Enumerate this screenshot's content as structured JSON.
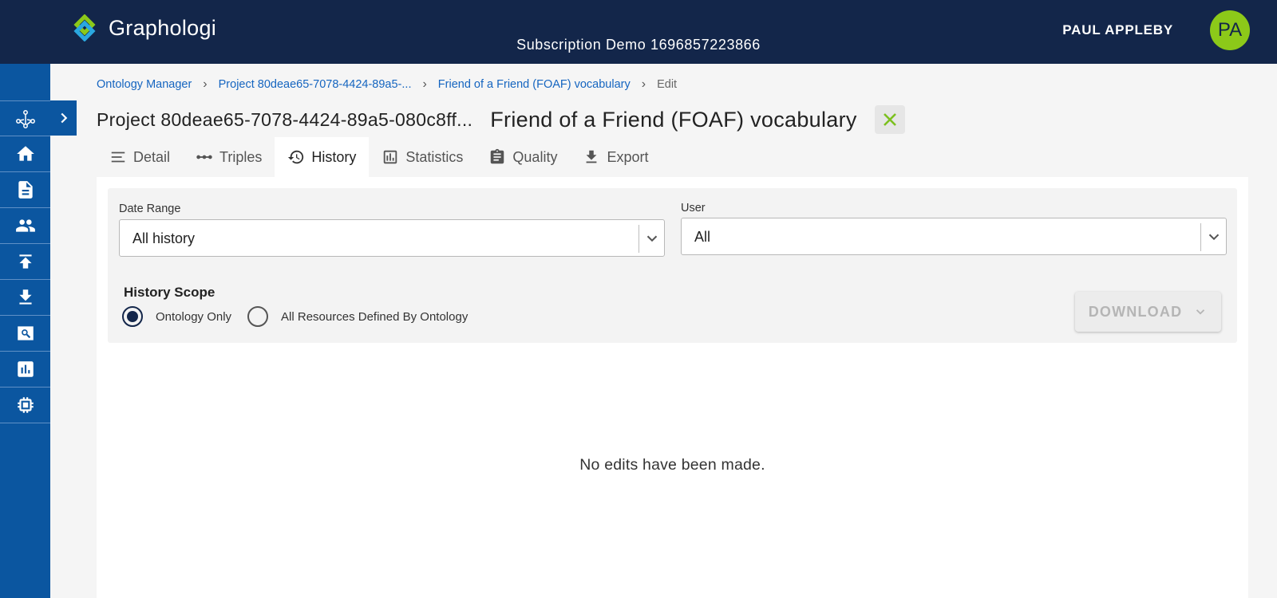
{
  "header": {
    "app_name": "Graphologi",
    "subscription": "Subscription Demo 1696857223866",
    "user_name": "PAUL APPLEBY",
    "avatar_initials": "PA",
    "brand_color": "#13264a",
    "avatar_color": "#8cc919"
  },
  "sidebar": {
    "items": [
      {
        "icon": "graph-icon"
      },
      {
        "icon": "home-icon"
      },
      {
        "icon": "document-icon"
      },
      {
        "icon": "users-icon"
      },
      {
        "icon": "upload-icon"
      },
      {
        "icon": "download-icon"
      },
      {
        "icon": "search-icon"
      },
      {
        "icon": "chart-icon"
      },
      {
        "icon": "chip-icon"
      }
    ],
    "expand_icon": "chevron-right-icon",
    "color": "#0b56a0"
  },
  "breadcrumb": {
    "items": [
      "Ontology Manager",
      "Project 80deae65-7078-4424-89a5-...",
      "Friend of a Friend (FOAF) vocabulary"
    ],
    "current": "Edit"
  },
  "title": {
    "project": "Project 80deae65-7078-4424-89a5-080c8ff...",
    "vocabulary": "Friend of a Friend (FOAF) vocabulary"
  },
  "tabs": [
    {
      "label": "Detail",
      "icon": "list-icon"
    },
    {
      "label": "Triples",
      "icon": "dots-icon"
    },
    {
      "label": "History",
      "icon": "history-icon",
      "active": true
    },
    {
      "label": "Statistics",
      "icon": "statistics-icon"
    },
    {
      "label": "Quality",
      "icon": "clipboard-icon"
    },
    {
      "label": "Export",
      "icon": "export-icon"
    }
  ],
  "filters": {
    "date_range_label": "Date Range",
    "date_range_value": "All history",
    "user_label": "User",
    "user_value": "All"
  },
  "scope": {
    "label": "History Scope",
    "options": [
      "Ontology Only",
      "All Resources Defined By Ontology"
    ],
    "selected": "Ontology Only"
  },
  "download_label": "DOWNLOAD",
  "empty_message": "No edits have been made."
}
